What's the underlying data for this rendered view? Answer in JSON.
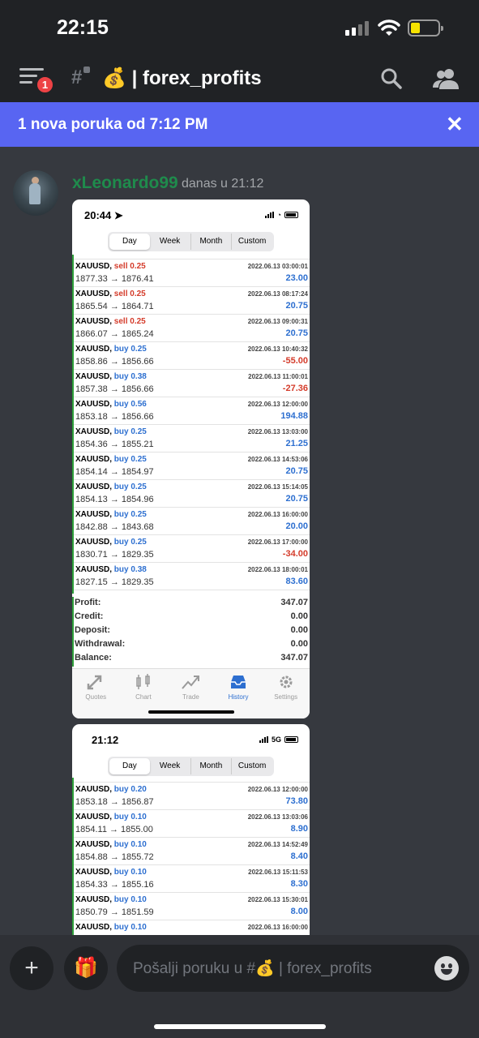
{
  "status_bar": {
    "time": "22:15"
  },
  "header": {
    "channel_emoji": "💰",
    "channel_name": "| forex_profits",
    "notification_count": "1"
  },
  "banner": {
    "text": "1 nova poruka od 7:12 PM",
    "close_glyph": "✕"
  },
  "message": {
    "author": "xLeonardo99",
    "timestamp": "danas u 21:12"
  },
  "screenshot1": {
    "time": "20:44 ➤",
    "tabs": [
      "Day",
      "Week",
      "Month",
      "Custom"
    ],
    "active_tab": "Day",
    "trades": [
      {
        "symbol": "XAUUSD,",
        "side": "sell 0.25",
        "dir": "sell",
        "prices": "1877.33 → 1876.41",
        "datetime": "2022.06.13 03:00:01",
        "profit": "23.00",
        "sign": "pos"
      },
      {
        "symbol": "XAUUSD,",
        "side": "sell 0.25",
        "dir": "sell",
        "prices": "1865.54 → 1864.71",
        "datetime": "2022.06.13 08:17:24",
        "profit": "20.75",
        "sign": "pos"
      },
      {
        "symbol": "XAUUSD,",
        "side": "sell 0.25",
        "dir": "sell",
        "prices": "1866.07 → 1865.24",
        "datetime": "2022.06.13 09:00:31",
        "profit": "20.75",
        "sign": "pos"
      },
      {
        "symbol": "XAUUSD,",
        "side": "buy 0.25",
        "dir": "buy",
        "prices": "1858.86 → 1856.66",
        "datetime": "2022.06.13 10:40:32",
        "profit": "-55.00",
        "sign": "neg"
      },
      {
        "symbol": "XAUUSD,",
        "side": "buy 0.38",
        "dir": "buy",
        "prices": "1857.38 → 1856.66",
        "datetime": "2022.06.13 11:00:01",
        "profit": "-27.36",
        "sign": "neg"
      },
      {
        "symbol": "XAUUSD,",
        "side": "buy 0.56",
        "dir": "buy",
        "prices": "1853.18 → 1856.66",
        "datetime": "2022.06.13 12:00:00",
        "profit": "194.88",
        "sign": "pos"
      },
      {
        "symbol": "XAUUSD,",
        "side": "buy 0.25",
        "dir": "buy",
        "prices": "1854.36 → 1855.21",
        "datetime": "2022.06.13 13:03:00",
        "profit": "21.25",
        "sign": "pos"
      },
      {
        "symbol": "XAUUSD,",
        "side": "buy 0.25",
        "dir": "buy",
        "prices": "1854.14 → 1854.97",
        "datetime": "2022.06.13 14:53:06",
        "profit": "20.75",
        "sign": "pos"
      },
      {
        "symbol": "XAUUSD,",
        "side": "buy 0.25",
        "dir": "buy",
        "prices": "1854.13 → 1854.96",
        "datetime": "2022.06.13 15:14:05",
        "profit": "20.75",
        "sign": "pos"
      },
      {
        "symbol": "XAUUSD,",
        "side": "buy 0.25",
        "dir": "buy",
        "prices": "1842.88 → 1843.68",
        "datetime": "2022.06.13 16:00:00",
        "profit": "20.00",
        "sign": "pos"
      },
      {
        "symbol": "XAUUSD,",
        "side": "buy 0.25",
        "dir": "buy",
        "prices": "1830.71 → 1829.35",
        "datetime": "2022.06.13 17:00:00",
        "profit": "-34.00",
        "sign": "neg"
      },
      {
        "symbol": "XAUUSD,",
        "side": "buy 0.38",
        "dir": "buy",
        "prices": "1827.15 → 1829.35",
        "datetime": "2022.06.13 18:00:01",
        "profit": "83.60",
        "sign": "pos"
      }
    ],
    "summary": [
      {
        "label": "Profit:",
        "value": "347.07"
      },
      {
        "label": "Credit:",
        "value": "0.00"
      },
      {
        "label": "Deposit:",
        "value": "0.00"
      },
      {
        "label": "Withdrawal:",
        "value": "0.00"
      },
      {
        "label": "Balance:",
        "value": "347.07"
      }
    ],
    "bottom_tabs": [
      {
        "label": "Quotes",
        "icon": "quotes-icon"
      },
      {
        "label": "Chart",
        "icon": "chart-icon"
      },
      {
        "label": "Trade",
        "icon": "trade-icon"
      },
      {
        "label": "History",
        "icon": "history-icon",
        "active": true
      },
      {
        "label": "Settings",
        "icon": "settings-icon"
      }
    ]
  },
  "screenshot2": {
    "time": "21:12",
    "network": "5G",
    "tabs": [
      "Day",
      "Week",
      "Month",
      "Custom"
    ],
    "active_tab": "Day",
    "trades": [
      {
        "symbol": "XAUUSD,",
        "side": "buy 0.20",
        "dir": "buy",
        "prices": "1853.18 → 1856.87",
        "datetime": "2022.06.13 12:00:00",
        "profit": "73.80",
        "sign": "pos"
      },
      {
        "symbol": "XAUUSD,",
        "side": "buy 0.10",
        "dir": "buy",
        "prices": "1854.11 → 1855.00",
        "datetime": "2022.06.13 13:03:06",
        "profit": "8.90",
        "sign": "pos"
      },
      {
        "symbol": "XAUUSD,",
        "side": "buy 0.10",
        "dir": "buy",
        "prices": "1854.88 → 1855.72",
        "datetime": "2022.06.13 14:52:49",
        "profit": "8.40",
        "sign": "pos"
      },
      {
        "symbol": "XAUUSD,",
        "side": "buy 0.10",
        "dir": "buy",
        "prices": "1854.33 → 1855.16",
        "datetime": "2022.06.13 15:11:53",
        "profit": "8.30",
        "sign": "pos"
      },
      {
        "symbol": "XAUUSD,",
        "side": "buy 0.10",
        "dir": "buy",
        "prices": "1850.79 → 1851.59",
        "datetime": "2022.06.13 15:30:01",
        "profit": "8.00",
        "sign": "pos"
      },
      {
        "symbol": "XAUUSD,",
        "side": "buy 0.10",
        "dir": "buy",
        "prices": "",
        "datetime": "2022.06.13 16:00:00",
        "profit": "",
        "sign": "pos"
      }
    ]
  },
  "composer": {
    "placeholder": "Pošalji poruku u #💰 | forex_profits",
    "plus_glyph": "+",
    "gift_glyph": "🎁"
  },
  "colors": {
    "blurple": "#5865f2",
    "author_green": "#1f8b4c",
    "buy_blue": "#2d6fd0",
    "sell_red": "#d43b2a"
  }
}
